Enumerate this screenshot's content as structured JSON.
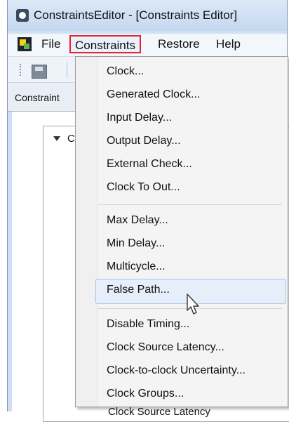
{
  "window": {
    "title": "ConstraintsEditor - [Constraints Editor]"
  },
  "menubar": {
    "items": [
      "File",
      "Constraints",
      "Restore",
      "Help"
    ]
  },
  "tab": {
    "label": "Constraint"
  },
  "tree": {
    "root_label": "C"
  },
  "background_row": {
    "text": "Clock Source Latency"
  },
  "dropdown": {
    "items": [
      "Clock...",
      "Generated Clock...",
      "Input Delay...",
      "Output Delay...",
      "External Check...",
      "Clock To Out...",
      "Max Delay...",
      "Min Delay...",
      "Multicycle...",
      "False Path...",
      "Disable Timing...",
      "Clock Source Latency...",
      "Clock-to-clock Uncertainty...",
      "Clock Groups..."
    ],
    "highlighted": "False Path..."
  },
  "colors": {
    "active_menu_border": "#e0252c",
    "hover_bg": "#e5eef9"
  },
  "icons": [
    "app-icon",
    "app-logo-icon",
    "save-icon",
    "tree-collapse-icon",
    "mouse-cursor-icon"
  ]
}
